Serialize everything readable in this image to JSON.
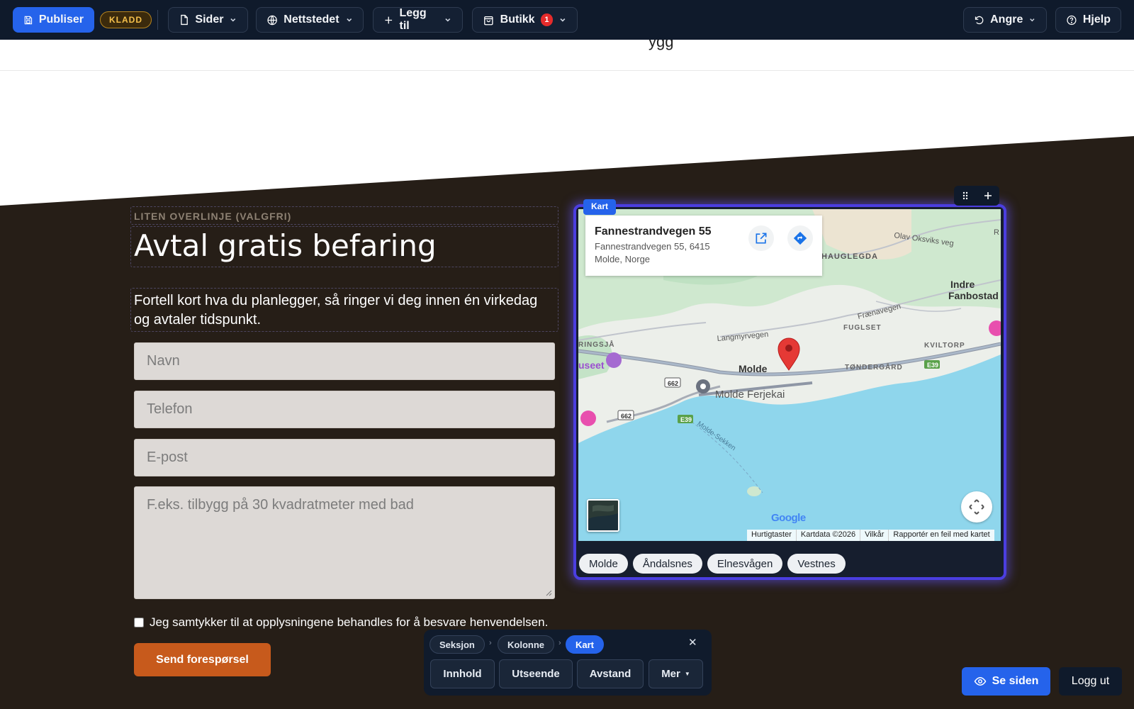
{
  "toolbar": {
    "publish_label": "Publiser",
    "draft_badge": "KLADD",
    "pages_label": "Sider",
    "site_label": "Nettstedet",
    "add_label": "Legg til",
    "shop_label": "Butikk",
    "shop_count": "1",
    "undo_label": "Angre",
    "help_label": "Hjelp"
  },
  "nav_fragment": "ygg",
  "section": {
    "overline": "LITEN OVERLINJE (VALGFRI)",
    "title": "Avtal gratis befaring",
    "lead": "Fortell kort hva du planlegger, så ringer vi deg innen én virkedag og avtaler tidspunkt."
  },
  "form": {
    "name_placeholder": "Navn",
    "phone_placeholder": "Telefon",
    "email_placeholder": "E-post",
    "message_placeholder": "F.eks. tilbygg på 30 kvadratmeter med bad",
    "consent_label": "Jeg samtykker til at opplysningene behandles for å besvare henvendelsen.",
    "submit_label": "Send forespørsel"
  },
  "map": {
    "block_tag": "Kart",
    "place_title": "Fannestrandvegen 55",
    "address_line1": "Fannestrandvegen 55, 6415",
    "address_line2": "Molde, Norge",
    "labels": {
      "city": "Molde",
      "ferry": "Molde Ferjekai",
      "hauglegda": "HAUGLEGDA",
      "indre": "Indre",
      "fanbostad": "Fanbostad",
      "olav": "Olav Oksviks veg",
      "fraena": "Frænavegen",
      "fuglset": "FUGLSET",
      "kviltorp": "KVILTORP",
      "tondergard": "TØNDERGÅRD",
      "langmyr": "Langmyrvegen",
      "ringsja": "RINGSJÅ",
      "museet": "useet",
      "sekken": "Molde-Sekken",
      "road662a": "662",
      "road662b": "662",
      "e39a": "E39",
      "e39b": "E39",
      "edge_r": "R"
    },
    "google_logo": "Google",
    "attribution": [
      "Hurtigtaster",
      "Kartdata ©2026",
      "Vilkår",
      "Rapportér en feil med kartet"
    ],
    "chips": [
      "Molde",
      "Åndalsnes",
      "Elnesvågen",
      "Vestnes"
    ]
  },
  "editor": {
    "breadcrumb": [
      "Seksjon",
      "Kolonne",
      "Kart"
    ],
    "tabs": [
      "Innhold",
      "Utseende",
      "Avstand",
      "Mer"
    ]
  },
  "footer": {
    "view_label": "Se siden",
    "logout_label": "Logg ut"
  },
  "colors": {
    "toolbar_bg": "#0f1a2b",
    "accent": "#2563eb",
    "section_bg": "#261e17",
    "submit": "#c75a1c",
    "selection": "#4b3ee0"
  }
}
